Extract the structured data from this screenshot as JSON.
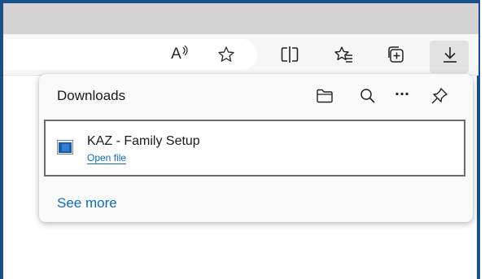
{
  "toolbar": {
    "icons": [
      "read-aloud-icon",
      "favorite-star-icon",
      "split-screen-icon",
      "favorites-icon",
      "collections-icon",
      "downloads-icon"
    ],
    "read_aloud_label": "A"
  },
  "downloads": {
    "title": "Downloads",
    "header_icons": [
      "open-folder-icon",
      "search-icon",
      "more-options-icon",
      "pin-icon"
    ],
    "more_label": "···",
    "items": [
      {
        "name": "KAZ - Family Setup",
        "action": "Open file",
        "icon": "installer-file-icon"
      }
    ],
    "see_more": "See more"
  },
  "colors": {
    "frame": "#1b4f8a",
    "titlebar": "#d3d3d3",
    "toolbar": "#f7f7f7",
    "link": "#0f6cbd",
    "item_border": "#6b6b6b"
  }
}
